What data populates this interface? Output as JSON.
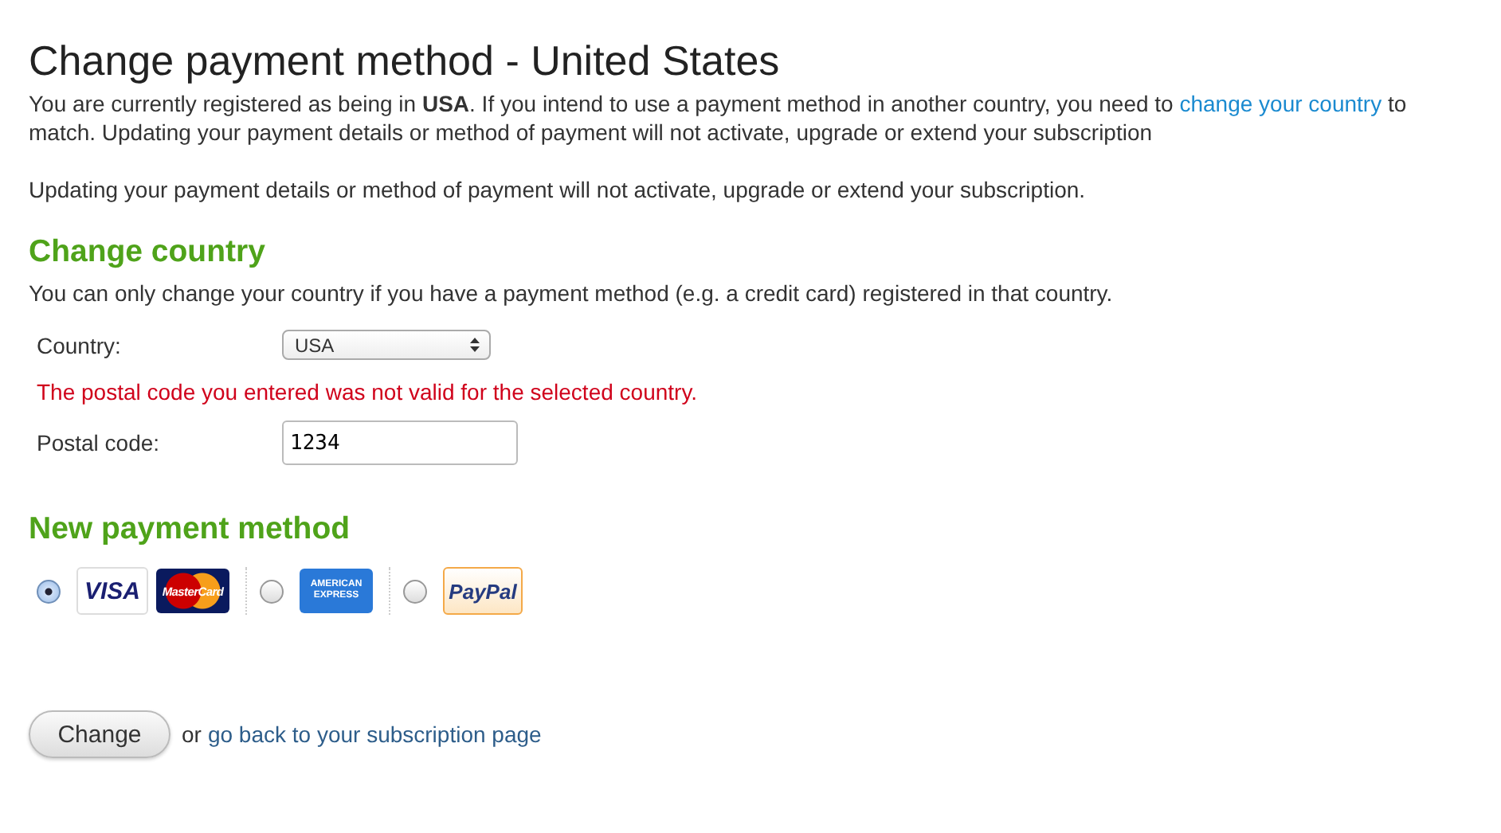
{
  "title": "Change payment method - United States",
  "intro": {
    "before": "You are currently registered as being in **USA**. If you intend to use a payment method in another country, you need to",
    "link": "change your country",
    "after": "to match. Updating your payment details or method of payment will not activate, upgrade or extend your subscription"
  },
  "notice": "Updating your payment details or method of payment will not activate, upgrade or extend your subscription.",
  "country_section": {
    "heading": "Change country",
    "description": "You can only change your country if you have a payment method (e.g. a credit card) registered in that country.",
    "country": {
      "label": "Country:",
      "value": "USA"
    },
    "error": "The postal code you entered was not valid for the selected country.",
    "postal": {
      "label": "Postal code:",
      "value": "1234"
    }
  },
  "payment_section": {
    "heading": "New payment method",
    "options": [
      {
        "selected": true,
        "cards": [
          {
            "kind": "visa",
            "label": "VISA"
          },
          {
            "kind": "mastercard",
            "label": "MasterCard"
          }
        ]
      },
      {
        "selected": false,
        "cards": [
          {
            "kind": "amex",
            "label": "AMERICAN EXPRESS"
          }
        ]
      },
      {
        "selected": false,
        "cards": [
          {
            "kind": "paypal",
            "label": "PayPal"
          }
        ]
      }
    ]
  },
  "footer": {
    "button": "Change",
    "or": "or",
    "link": "go back to your subscription page"
  }
}
